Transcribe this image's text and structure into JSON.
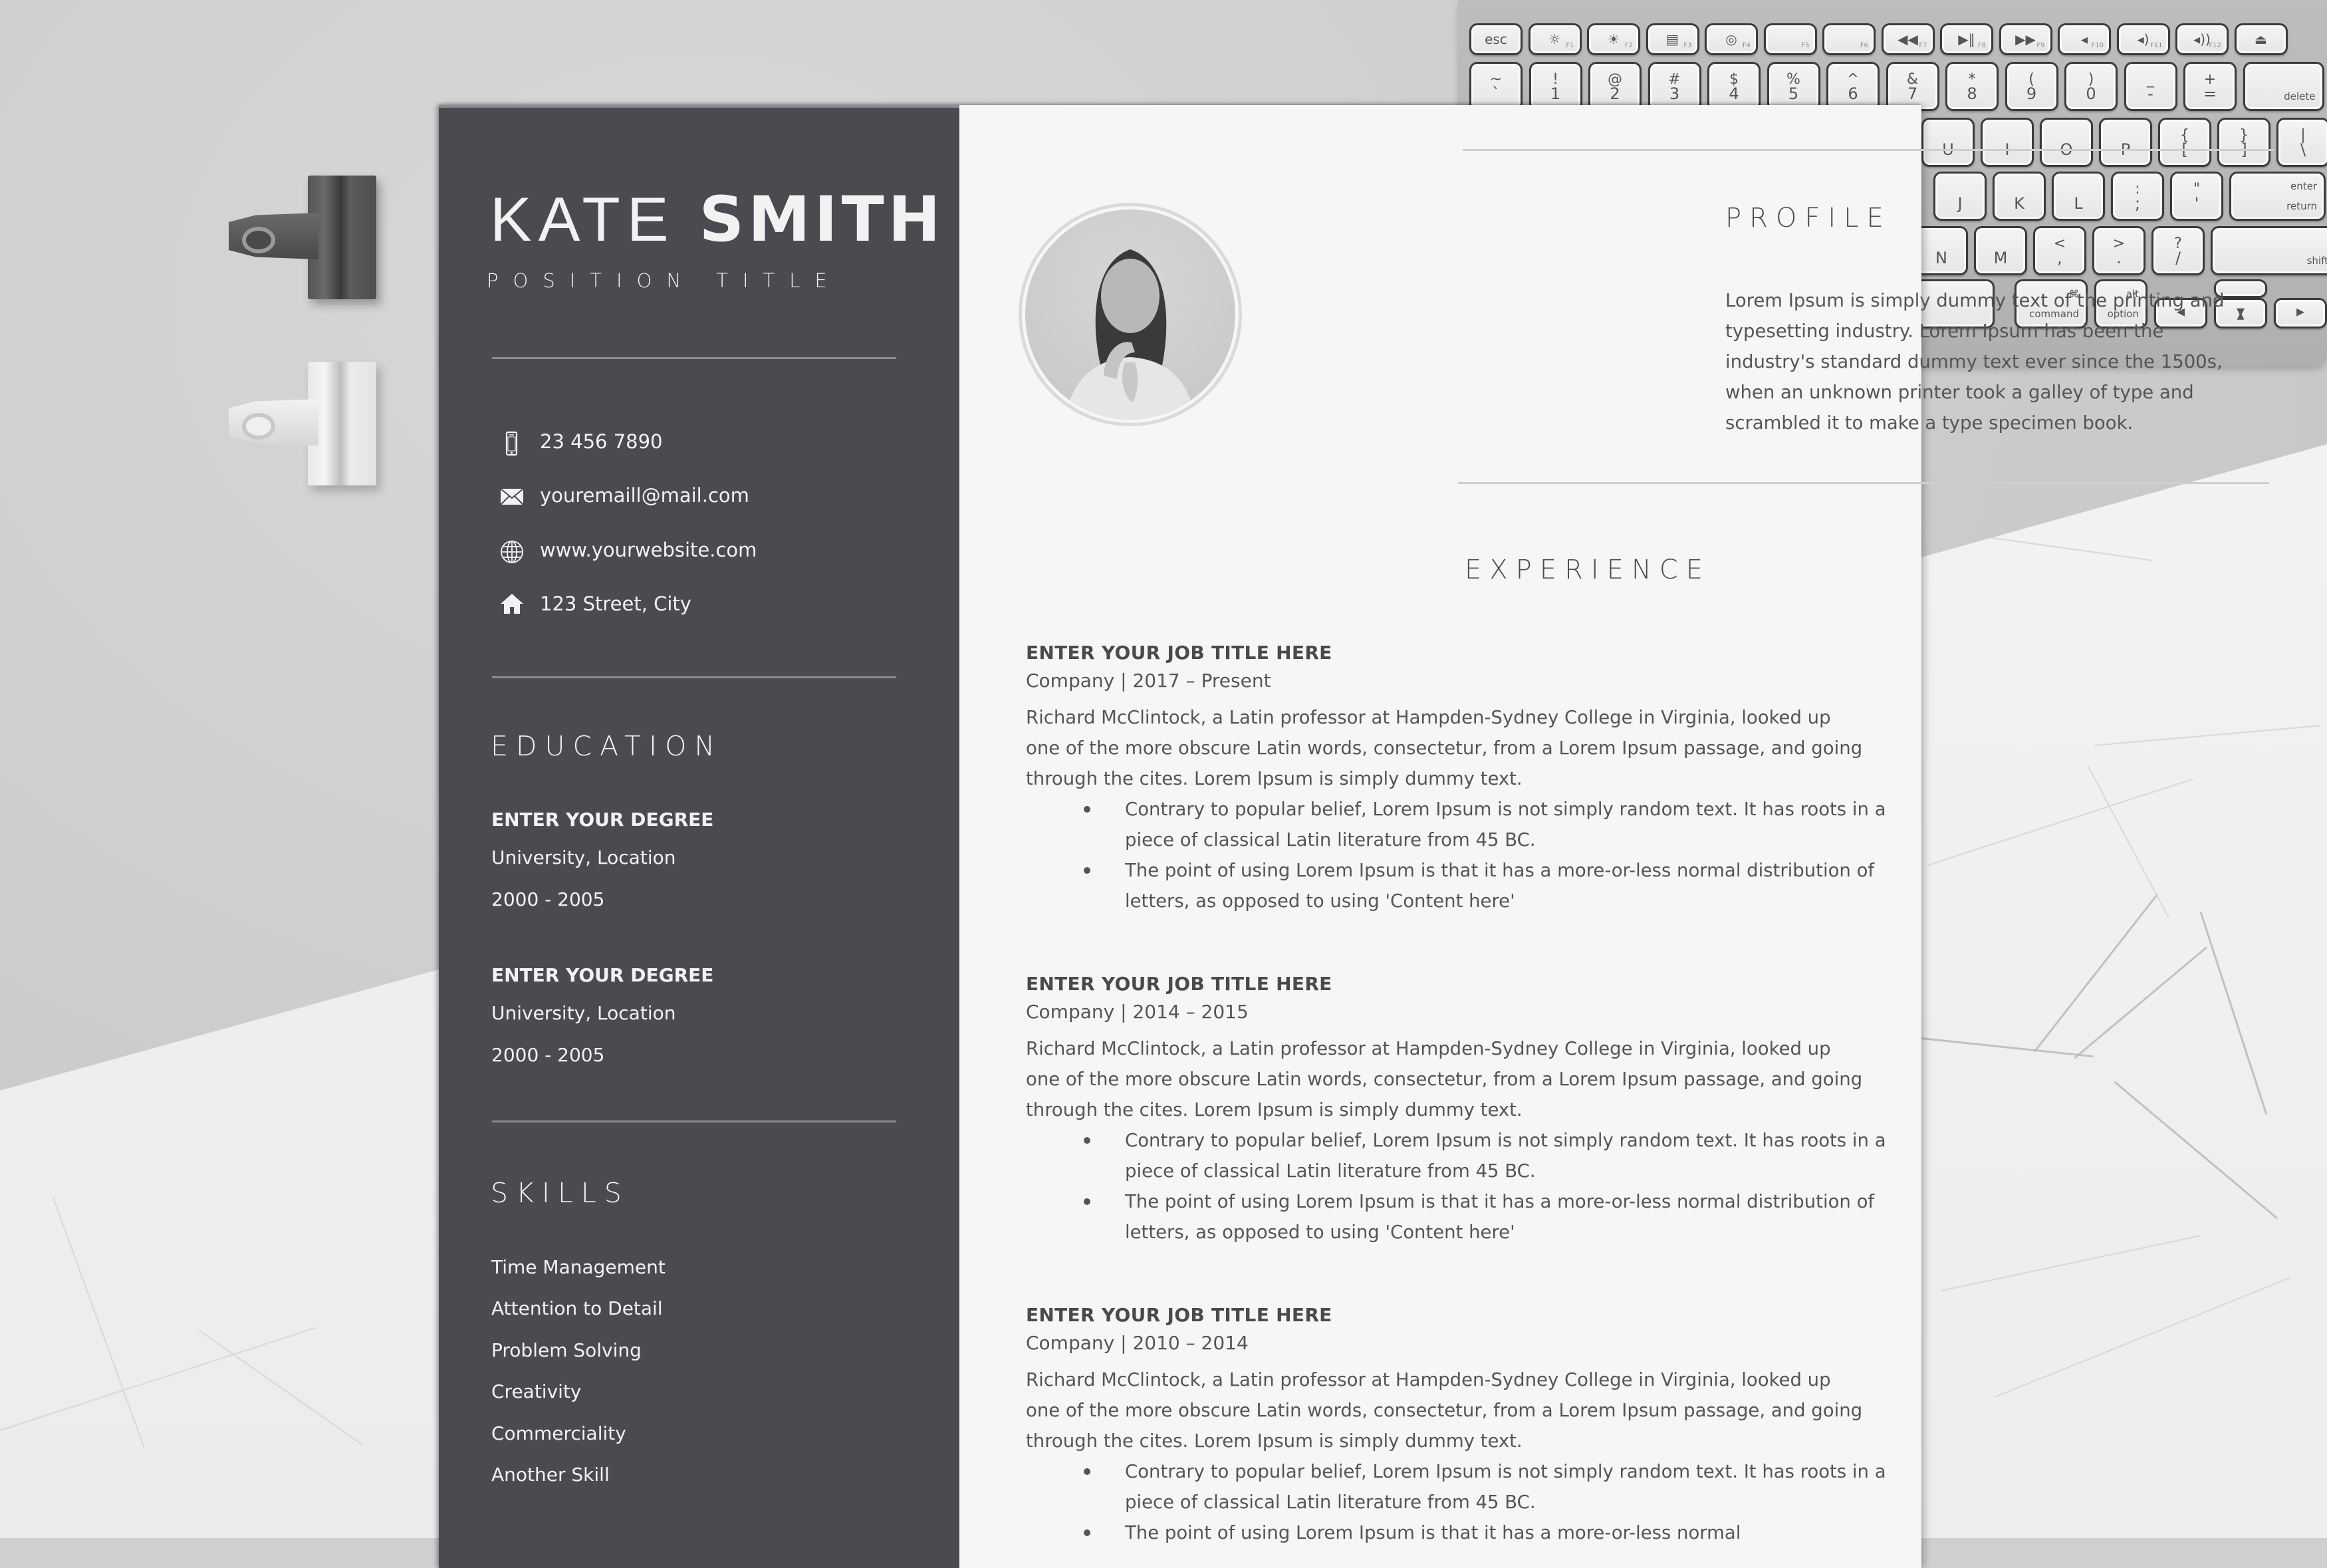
{
  "resume": {
    "name_first": "KATE",
    "name_last": "SMITH",
    "position_title": "POSITION TITLE",
    "contacts": [
      {
        "icon": "phone-icon",
        "text": "23 456 7890"
      },
      {
        "icon": "mail-icon",
        "text": "youremaill@mail.com"
      },
      {
        "icon": "globe-icon",
        "text": "www.yourwebsite.com"
      },
      {
        "icon": "home-icon",
        "text": "123 Street, City"
      }
    ],
    "education": {
      "heading": "EDUCATION",
      "items": [
        {
          "degree": "ENTER YOUR DEGREE",
          "school": "University, Location",
          "years": "2000 - 2005"
        },
        {
          "degree": "ENTER YOUR DEGREE",
          "school": "University, Location",
          "years": "2000 - 2005"
        }
      ]
    },
    "skills": {
      "heading": "SKILLS",
      "items": [
        "Time Management",
        "Attention to Detail",
        "Problem Solving",
        "Creativity",
        "Commerciality",
        "Another Skill"
      ]
    },
    "profile": {
      "heading": "PROFILE",
      "text": "Lorem Ipsum is simply dummy text of the printing and typesetting industry. Lorem Ipsum has been the industry's standard dummy text ever since the 1500s, when an unknown printer took a galley of type and scrambled it to make a type specimen book."
    },
    "experience": {
      "heading": "EXPERIENCE",
      "jobs": [
        {
          "title": "ENTER YOUR JOB TITLE HERE",
          "meta": "Company  |  2017 – Present",
          "description": "Richard McClintock, a Latin professor at Hampden-Sydney College in Virginia, looked up one of the more obscure Latin words, consectetur, from a Lorem Ipsum passage, and going through the cites. Lorem Ipsum is simply dummy text.",
          "bullets": [
            "Contrary to popular belief, Lorem Ipsum is not simply random text. It has roots in a piece of classical Latin literature from 45 BC.",
            "The point of using Lorem Ipsum is that it has a more-or-less normal distribution of letters, as opposed to using 'Content here'"
          ]
        },
        {
          "title": "ENTER YOUR JOB TITLE HERE",
          "meta": "Company  |  2014 – 2015",
          "description": "Richard McClintock, a Latin professor at Hampden-Sydney College in Virginia, looked up one of the more obscure Latin words, consectetur, from a Lorem Ipsum passage, and going through the cites. Lorem Ipsum is simply dummy text.",
          "bullets": [
            "Contrary to popular belief, Lorem Ipsum is not simply random text. It has roots in a piece of classical Latin literature from 45 BC.",
            "The point of using Lorem Ipsum is that it has a more-or-less normal distribution of letters, as opposed to using 'Content here'"
          ]
        },
        {
          "title": "ENTER YOUR JOB TITLE HERE",
          "meta": "Company  |  2010 – 2014",
          "description": "Richard McClintock, a Latin professor at Hampden-Sydney College in Virginia, looked up one of the more obscure Latin words, consectetur, from a Lorem Ipsum passage, and going through the cites. Lorem Ipsum is simply dummy text.",
          "bullets": [
            "Contrary to popular belief, Lorem Ipsum is not simply random text. It has roots in a piece of classical Latin literature from 45 BC.",
            "The point of using Lorem Ipsum is that it has a more-or-less normal"
          ]
        }
      ]
    }
  },
  "keyboard": {
    "function_row": [
      {
        "label": "esc",
        "fn": ""
      },
      {
        "label": "☼",
        "fn": "F1"
      },
      {
        "label": "☀",
        "fn": "F2"
      },
      {
        "label": "▤",
        "fn": "F3"
      },
      {
        "label": "◎",
        "fn": "F4"
      },
      {
        "label": "",
        "fn": "F5"
      },
      {
        "label": "",
        "fn": "F6"
      },
      {
        "label": "◀◀",
        "fn": "F7"
      },
      {
        "label": "▶‖",
        "fn": "F8"
      },
      {
        "label": "▶▶",
        "fn": "F9"
      },
      {
        "label": "◂",
        "fn": "F10"
      },
      {
        "label": "◂)",
        "fn": "F11"
      },
      {
        "label": "◂))",
        "fn": "F12"
      },
      {
        "label": "⏏",
        "fn": ""
      }
    ],
    "number_row": [
      {
        "top": "~",
        "bottom": "`"
      },
      {
        "top": "!",
        "bottom": "1"
      },
      {
        "top": "@",
        "bottom": "2"
      },
      {
        "top": "#",
        "bottom": "3"
      },
      {
        "top": "$",
        "bottom": "4"
      },
      {
        "top": "%",
        "bottom": "5"
      },
      {
        "top": "^",
        "bottom": "6"
      },
      {
        "top": "&",
        "bottom": "7"
      },
      {
        "top": "*",
        "bottom": "8"
      },
      {
        "top": "(",
        "bottom": "9"
      },
      {
        "top": ")",
        "bottom": "0"
      },
      {
        "top": "_",
        "bottom": "-"
      },
      {
        "top": "+",
        "bottom": "="
      },
      {
        "top": "",
        "bottom": "delete"
      }
    ],
    "top_row_visible": [
      {
        "top": "",
        "bottom": "U"
      },
      {
        "top": "",
        "bottom": "I"
      },
      {
        "top": "",
        "bottom": "O"
      },
      {
        "top": "",
        "bottom": "P"
      },
      {
        "top": "{",
        "bottom": "["
      },
      {
        "top": "}",
        "bottom": "]"
      },
      {
        "top": "|",
        "bottom": "\\"
      }
    ],
    "home_row_visible": [
      {
        "top": "",
        "bottom": "J"
      },
      {
        "top": "",
        "bottom": "K"
      },
      {
        "top": "",
        "bottom": "L"
      },
      {
        "top": ":",
        "bottom": ";"
      },
      {
        "top": "\"",
        "bottom": "'"
      },
      {
        "top": "enter",
        "bottom": "return"
      }
    ],
    "bottom_row_visible": [
      {
        "top": "",
        "bottom": "N"
      },
      {
        "top": "",
        "bottom": "M"
      },
      {
        "top": "<",
        "bottom": ","
      },
      {
        "top": ">",
        "bottom": "."
      },
      {
        "top": "?",
        "bottom": "/"
      },
      {
        "top": "",
        "bottom": "shift"
      }
    ],
    "modifier_row_visible": [
      {
        "top": "",
        "bottom": ""
      },
      {
        "top": "⌘",
        "bottom": "command"
      },
      {
        "top": "alt",
        "bottom": "option"
      },
      {
        "top": "",
        "bottom": "◂"
      },
      {
        "top": "▴",
        "bottom": "▾"
      },
      {
        "top": "",
        "bottom": "▸"
      }
    ]
  }
}
